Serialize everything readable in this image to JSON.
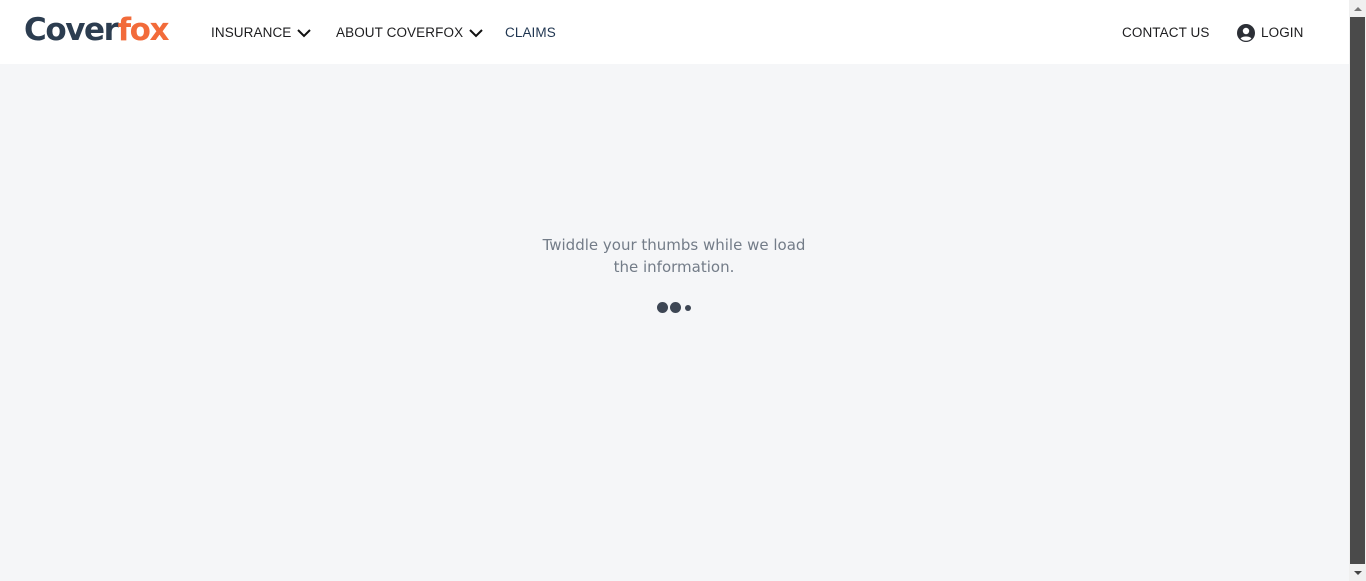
{
  "brand": {
    "part1": "Cover",
    "part2": "fox",
    "colors": {
      "primary": "#2c3d50",
      "accent": "#f26b3a"
    }
  },
  "nav": {
    "insurance": "INSURANCE",
    "about": "ABOUT COVERFOX",
    "claims": "CLAIMS",
    "contact": "CONTACT US",
    "login": "LOGIN",
    "icons": {
      "dropdown": "chevron-down-icon",
      "user": "user-circle-icon"
    }
  },
  "loader": {
    "line1": "Twiddle your thumbs while we load",
    "line2": "the information."
  }
}
